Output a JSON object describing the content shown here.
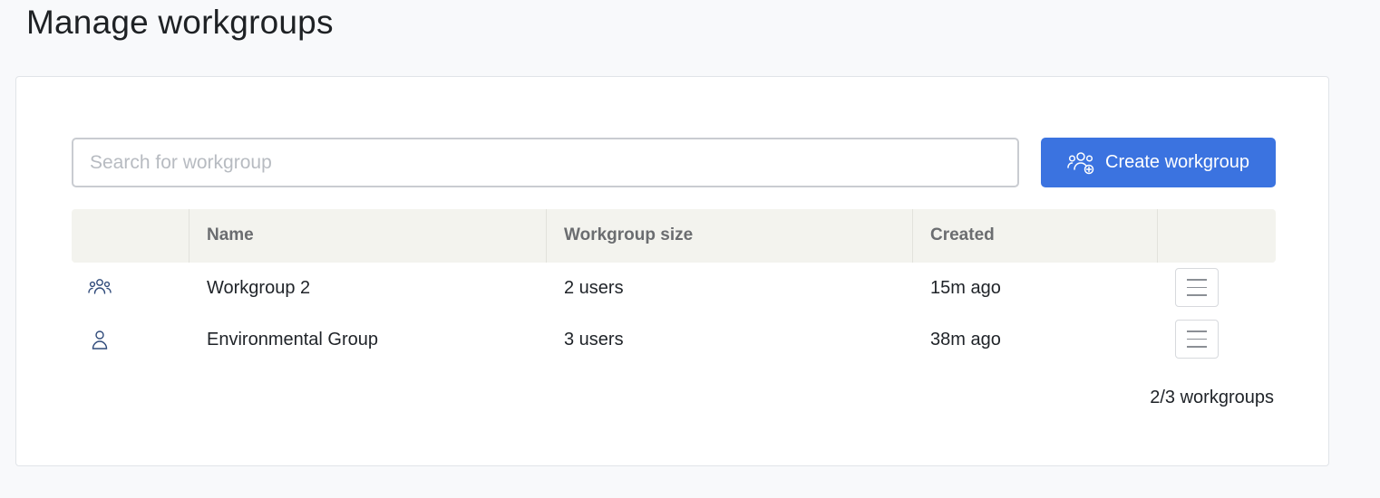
{
  "page": {
    "title": "Manage workgroups"
  },
  "toolbar": {
    "search_placeholder": "Search for workgroup",
    "search_value": "",
    "create_label": "Create workgroup",
    "create_icon": "group-add-icon",
    "accent_color": "#3b73e0"
  },
  "table": {
    "headers": {
      "icon": "",
      "name": "Name",
      "size": "Workgroup size",
      "created": "Created",
      "actions": ""
    },
    "rows": [
      {
        "icon": "group-icon",
        "name": "Workgroup 2",
        "size": "2 users",
        "created": "15m ago",
        "menu_icon": "hamburger-menu-icon"
      },
      {
        "icon": "user-icon",
        "name": "Environmental Group",
        "size": "3 users",
        "created": "38m ago",
        "menu_icon": "hamburger-menu-icon"
      }
    ]
  },
  "footer": {
    "count_label": "2/3 workgroups"
  }
}
